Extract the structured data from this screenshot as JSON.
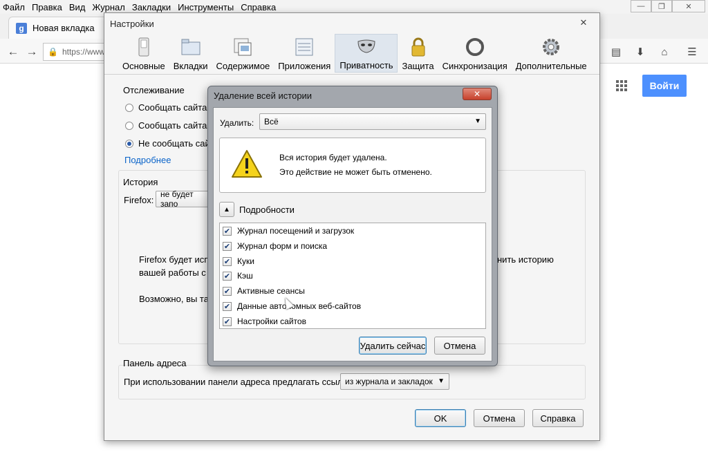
{
  "menu": [
    "Файл",
    "Правка",
    "Вид",
    "Журнал",
    "Закладки",
    "Инструменты",
    "Справка"
  ],
  "tab": {
    "title": "Новая вкладка",
    "favicon": "g"
  },
  "url": {
    "value": "https://www"
  },
  "google": {
    "signin": "Войти"
  },
  "settings": {
    "title": "Настройки",
    "panes": [
      {
        "label": "Основные",
        "icon": "switch-icon"
      },
      {
        "label": "Вкладки",
        "icon": "tabs-icon"
      },
      {
        "label": "Содержимое",
        "icon": "content-icon"
      },
      {
        "label": "Приложения",
        "icon": "applications-icon"
      },
      {
        "label": "Приватность",
        "icon": "privacy-mask-icon"
      },
      {
        "label": "Защита",
        "icon": "lock-icon"
      },
      {
        "label": "Синхронизация",
        "icon": "sync-icon"
      },
      {
        "label": "Дополнительные",
        "icon": "gear-icon"
      }
    ],
    "active_pane": "Приватность",
    "tracking": {
      "heading": "Отслеживание",
      "options": [
        "Сообщать сайтам, что я не хочу, чтобы меня отслеживали",
        "Сообщать сайтам",
        "Не сообщать сайт"
      ],
      "selected": 2,
      "more_link": "Подробнее"
    },
    "history": {
      "heading": "История",
      "label": "Firefox:",
      "select_value": "не будет запо",
      "desc_line1": "Firefox будет испол",
      "desc_line1_tail": "нить историю",
      "desc_line2": "вашей работы с ве",
      "desc_line3": "Возможно, вы так"
    },
    "address_bar": {
      "heading": "Панель адреса",
      "label": "При использовании панели адреса предлагать ссылки:",
      "select_value": "из журнала и закладок"
    },
    "buttons": {
      "ok": "OK",
      "cancel": "Отмена",
      "help": "Справка"
    }
  },
  "clear_dialog": {
    "title": "Удаление всей истории",
    "close": "x",
    "range_label": "Удалить:",
    "range_value": "Всё",
    "warning_line1": "Вся история будет удалена.",
    "warning_line2": "Это действие не может быть отменено.",
    "details_label": "Подробности",
    "items": [
      {
        "label": "Журнал посещений и загрузок",
        "checked": true
      },
      {
        "label": "Журнал форм и поиска",
        "checked": true
      },
      {
        "label": "Куки",
        "checked": true
      },
      {
        "label": "Кэш",
        "checked": true
      },
      {
        "label": "Активные сеансы",
        "checked": true
      },
      {
        "label": "Данные автономных веб-сайтов",
        "checked": true
      },
      {
        "label": "Настройки сайтов",
        "checked": true
      }
    ],
    "clear_button": "Удалить сейчас",
    "cancel_button": "Отмена"
  },
  "colors": {
    "accent": "#4d90fe",
    "link": "#0a63c9",
    "active_pane": "#dfe6ee"
  }
}
